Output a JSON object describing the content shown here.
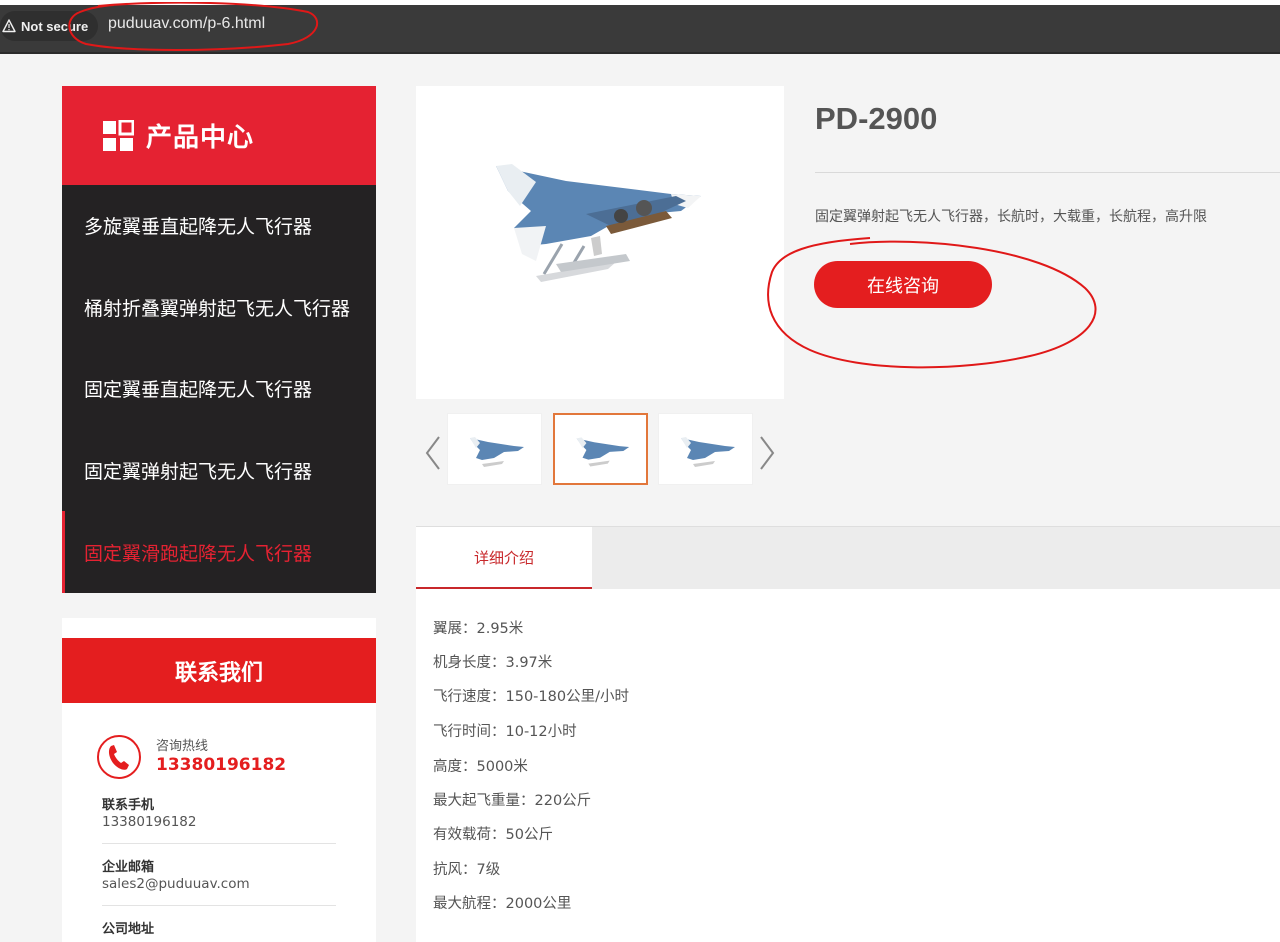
{
  "browser": {
    "security_label": "Not secure",
    "url": "puduuav.com/p-6.html"
  },
  "sidebar": {
    "header_title": "产品中心",
    "items": [
      {
        "label": "多旋翼垂直起降无人飞行器"
      },
      {
        "label": "桶射折叠翼弹射起飞无人飞行器"
      },
      {
        "label": "固定翼垂直起降无人飞行器"
      },
      {
        "label": "固定翼弹射起飞无人飞行器"
      },
      {
        "label": "固定翼滑跑起降无人飞行器"
      }
    ],
    "active_index": 4
  },
  "contact": {
    "title": "联系我们",
    "hotline_label": "咨询热线",
    "hotline_number": "13380196182",
    "mobile_label": "联系手机",
    "mobile_value": "13380196182",
    "email_label": "企业邮箱",
    "email_value": "sales2@puduuav.com",
    "address_label": "公司地址"
  },
  "product": {
    "title": "PD-2900",
    "description": "固定翼弹射起飞无人飞行器，长航时，大载重，长航程，高升限",
    "consult_button": "在线咨询",
    "selected_thumb": 2
  },
  "tabs": {
    "detail": "详细介绍"
  },
  "specs": [
    "翼展：2.95米",
    "机身长度：3.97米",
    "飞行速度：150-180公里/小时",
    "飞行时间：10-12小时",
    "高度：5000米",
    "最大起飞重量：220公斤",
    "有效载荷：50公斤",
    "抗风：7级",
    "最大航程：2000公里"
  ],
  "colors": {
    "brand_red": "#e52232",
    "sidebar_dark": "#242223",
    "annotation_red": "#e01818",
    "thumb_selected": "#e2773b"
  },
  "icons": {
    "security": "warning-triangle-icon",
    "category": "grid-icon",
    "phone": "phone-icon",
    "prev": "chevron-left-icon",
    "next": "chevron-right-icon"
  }
}
